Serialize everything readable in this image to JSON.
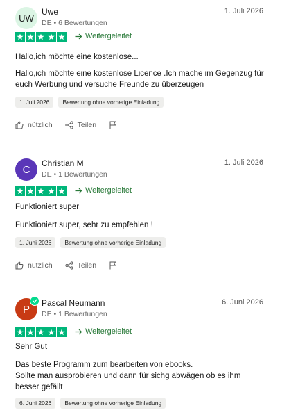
{
  "reviews": [
    {
      "initials": "UW",
      "name": "Uwe",
      "meta": "DE • 6 Bewertungen",
      "date": "1. Juli 2026",
      "rating": 5,
      "forwarded": "Weitergeleitet",
      "title": "Hallo,ich möchte eine kostenlose...",
      "body": [
        "Hallo,ich möchte eine kostenlose Licence .Ich mache im Gegenzug für",
        "euch Werbung und versuche Freunde zu überzeugen"
      ],
      "tags": [
        "1. Juli 2026",
        "Bewertung ohne vorherige Einladung"
      ],
      "helpful": "nützlich",
      "share": "Teilen"
    },
    {
      "initials": "C",
      "name": "Christian M",
      "meta": "DE • 1 Bewertungen",
      "date": "1. Juli 2026",
      "rating": 5,
      "forwarded": "Weitergeleitet",
      "title": "Funktioniert super",
      "body": [
        "Funktioniert super, sehr zu empfehlen !"
      ],
      "tags": [
        "1. Juni 2026",
        "Bewertung ohne vorherige Einladung"
      ],
      "helpful": "nützlich",
      "share": "Teilen"
    },
    {
      "initials": "P",
      "name": "Pascal Neumann",
      "meta": "DE • 1 Bewertungen",
      "date": "6. Juni 2026",
      "rating": 5,
      "forwarded": "Weitergeleitet",
      "title": "Sehr Gut",
      "body": [
        "Das beste Programm zum bearbeiten von ebooks.",
        "Sollte man ausprobieren und dann für sichg abwägen ob es ihm",
        "besser gefällt"
      ],
      "tags": [
        "6. Juni 2026",
        "Bewertung ohne vorherige Einladung"
      ]
    }
  ],
  "colors": {
    "star_green": "#00b67a",
    "forward_green": "#2a7a3a"
  }
}
